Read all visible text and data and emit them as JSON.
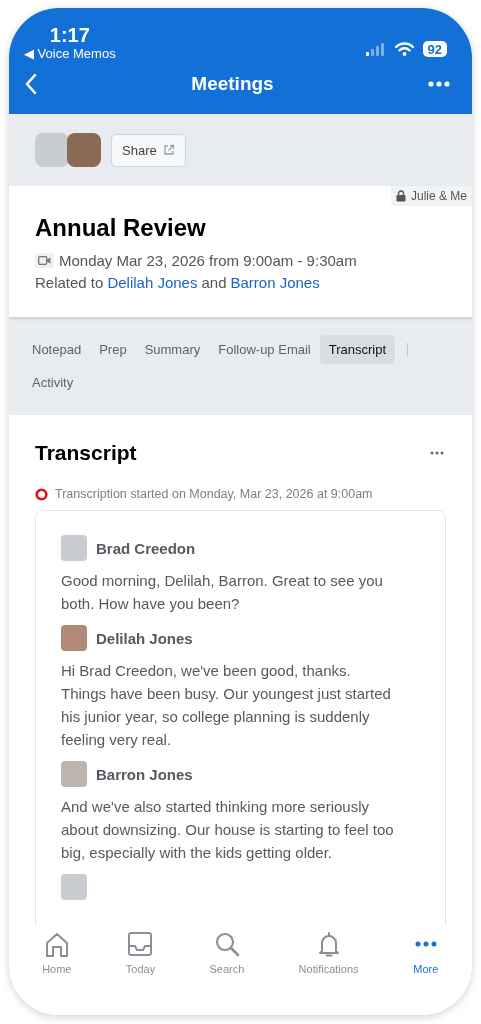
{
  "status_bar": {
    "time": "1:17",
    "back_app": "◀ Voice Memos",
    "battery": "92"
  },
  "nav": {
    "title": "Meetings"
  },
  "share": {
    "label": "Share"
  },
  "meeting": {
    "visibility": "Julie & Me",
    "title": "Annual Review",
    "when": "Monday Mar 23, 2026 from 9:00am - 9:30am",
    "related_prefix": "Related to",
    "related": [
      "Delilah Jones",
      "Barron Jones"
    ],
    "related_joiner": "and"
  },
  "tabs": [
    {
      "label": "Notepad",
      "selected": false
    },
    {
      "label": "Prep",
      "selected": false
    },
    {
      "label": "Summary",
      "selected": false
    },
    {
      "label": "Follow-up Email",
      "selected": false
    },
    {
      "label": "Transcript",
      "selected": true
    },
    {
      "label": "Activity",
      "selected": false
    }
  ],
  "transcript": {
    "title": "Transcript",
    "status": "Transcription started on Monday, Mar 23, 2026 at 9:00am",
    "entries": [
      {
        "speaker": "Brad Creedon",
        "text": "Good morning, Delilah, Barron. Great to see you both. How have you been?"
      },
      {
        "speaker": "Delilah Jones",
        "text": "Hi Brad Creedon, we've been good, thanks. Things have been busy. Our youngest just started his junior year, so college planning is suddenly feeling very real."
      },
      {
        "speaker": "Barron Jones",
        "text": "And we've also started thinking more seriously about downsizing. Our house is starting to feel too big, especially with the kids getting older."
      }
    ]
  },
  "tab_bar": [
    {
      "label": "Home",
      "kind": "home",
      "selected": false
    },
    {
      "label": "Today",
      "kind": "today",
      "selected": false
    },
    {
      "label": "Search",
      "kind": "search",
      "selected": false
    },
    {
      "label": "Notifications",
      "kind": "bell",
      "selected": false
    },
    {
      "label": "More",
      "kind": "more",
      "selected": true
    }
  ]
}
